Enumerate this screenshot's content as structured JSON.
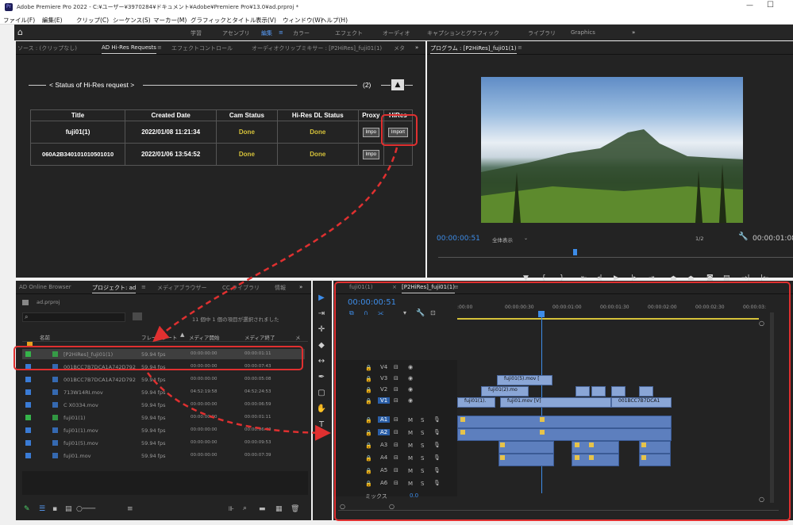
{
  "titlebar": {
    "title": "Adobe Premiere Pro 2022 - C:¥ユーザー¥3970284¥ドキュメント¥Adobe¥Premiere Pro¥13.0¥ad.prproj *"
  },
  "menubar": {
    "items": [
      "ファイル(F)",
      "編集(E)",
      "クリップ(C)",
      "シーケンス(S)",
      "マーカー(M)",
      "グラフィックとタイトル",
      "表示(V)",
      "ウィンドウ(W)",
      "ヘルプ(H)"
    ]
  },
  "workspaces": {
    "items": [
      "学習",
      "アセンブリ",
      "編集",
      "カラー",
      "エフェクト",
      "オーディオ",
      "キャプションとグラフィック",
      "ライブラリ",
      "Graphics"
    ],
    "more": "»"
  },
  "source_panel": {
    "tabs": [
      "ソース : (クリップなし)",
      "AD Hi-Res Requests",
      "エフェクトコントロール",
      "オーディオクリップミキサー : [P2HiRes]_fuji01(1)",
      "メタ"
    ],
    "more": "»"
  },
  "hires": {
    "status_title": "< Status of Hi-Res request >",
    "count": "(2)",
    "headers": [
      "Title",
      "Created Date",
      "Cam Status",
      "Hi-Res DL Status",
      "Proxy",
      "HiRes"
    ],
    "rows": [
      {
        "title": "fuji01(1)",
        "date": "2022/01/08 11:21:34",
        "cam": "Done",
        "dl": "Done",
        "proxy": "Impo",
        "hires": "Import"
      },
      {
        "title": "060A2B340101010501010",
        "date": "2022/01/06 13:54:52",
        "cam": "Done",
        "dl": "Done",
        "proxy": "Impo",
        "hires": ""
      }
    ]
  },
  "program": {
    "tab": "プログラム : [P2HiRes]_fuji01(1)",
    "timecode": "00:00:00:51",
    "fit": "全体表示",
    "scale": "1/2",
    "duration": "00:00:01:08"
  },
  "project": {
    "tabs": [
      "AD Online Browser",
      "プロジェクト: ad",
      "メディアブラウザー",
      "CC ライブラリ",
      "情報"
    ],
    "more": "»",
    "file": "ad.prproj",
    "search_placeholder": "",
    "selection_info": "11 個中 1 個の項目が選択されました",
    "headers": {
      "name": "名前",
      "fps": "フレームレート",
      "start": "メディア開始",
      "end": "メディア終了",
      "more": "メ"
    },
    "rows": [
      {
        "name": "[P2HiRes]_fuji01(1)",
        "fps": "59.94 fps",
        "start": "00:00:00:00",
        "end": "00:00:01:11",
        "color": "#35b34a",
        "selected": true
      },
      {
        "name": "001BCC7B7DCA1A742D792",
        "fps": "59.94 fps",
        "start": "00:00:00:00",
        "end": "00:00:07:43",
        "color": "#3a7bd5"
      },
      {
        "name": "001BCC7B7DCA1A742D792",
        "fps": "59.94 fps",
        "start": "00:00:00:00",
        "end": "00:00:05:08",
        "color": "#3a7bd5"
      },
      {
        "name": "713W14RI.mov",
        "fps": "59.94 fps",
        "start": "04:52:19:58",
        "end": "04:52:24:53",
        "color": "#3a7bd5"
      },
      {
        "name": "C X0334.mov",
        "fps": "59.94 fps",
        "start": "00:00:00:00",
        "end": "00:00:06:59",
        "color": "#3a7bd5"
      },
      {
        "name": "fuji01(1)",
        "fps": "59.94 fps",
        "start": "00:00:00:00",
        "end": "00:00:01:11",
        "color": "#35b34a"
      },
      {
        "name": "fuji01(1).mov",
        "fps": "59.94 fps",
        "start": "00:00:00:00",
        "end": "00:00:06:40",
        "color": "#3a7bd5"
      },
      {
        "name": "fuji01(5).mov",
        "fps": "59.94 fps",
        "start": "00:00:00:00",
        "end": "00:00:09:53",
        "color": "#3a7bd5"
      },
      {
        "name": "fuji01.mov",
        "fps": "59.94 fps",
        "start": "00:00:00:00",
        "end": "00:00:07:39",
        "color": "#3a7bd5"
      }
    ]
  },
  "timeline": {
    "tabs": [
      "fuji01(1)",
      "[P2HiRes]_fuji01(1)"
    ],
    "timecode": "00:00:00:51",
    "ruler": [
      ":00:00",
      "00:00:00:30",
      "00:00:01:00",
      "00:00:01:30",
      "00:00:02:00",
      "00:00:02:30",
      "00:00:03:"
    ],
    "video_tracks": [
      "V4",
      "V3",
      "V2",
      "V1"
    ],
    "audio_tracks": [
      "A1",
      "A2",
      "A3",
      "A4",
      "A5",
      "A6"
    ],
    "mix_label": "ミックス",
    "mix_value": "0.0",
    "clips": {
      "v3": "fuji01(5).mov [",
      "v2": "fuji01(2).mo",
      "v1a": "fuji01(1).",
      "v1b": "fuji01.mov [V]",
      "v1c": "001BCC7B7DCA1"
    }
  }
}
